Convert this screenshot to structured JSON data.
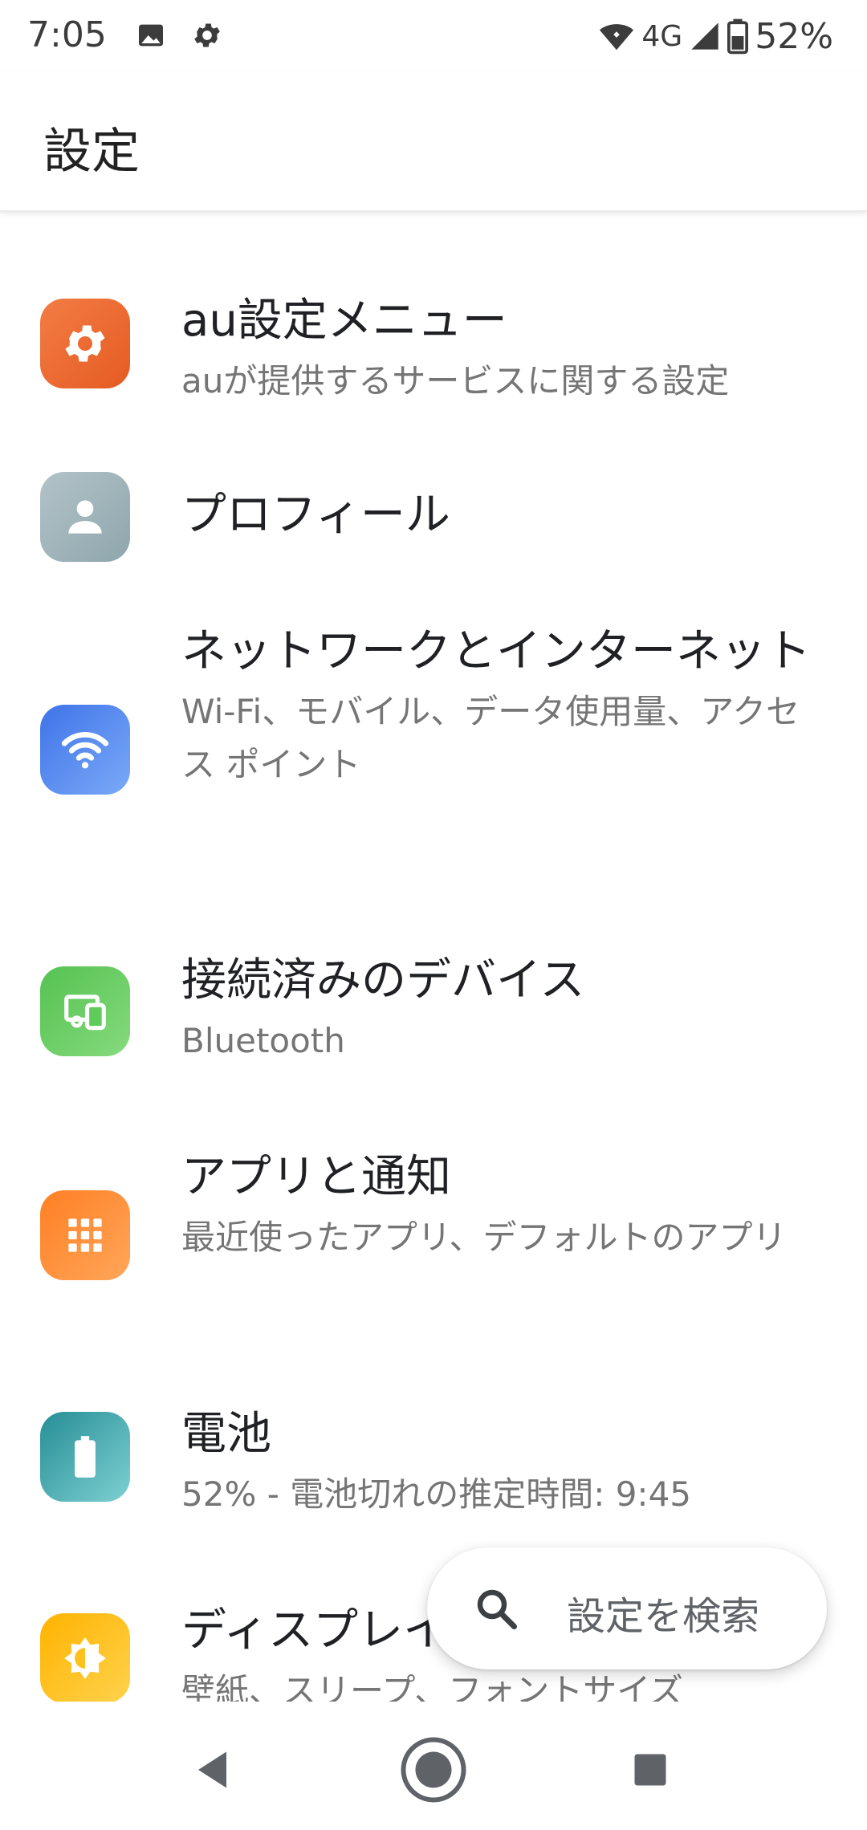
{
  "status_bar": {
    "time": "7:05",
    "icons": [
      "image-icon",
      "gear-icon"
    ],
    "network": "4G",
    "battery_percent": "52%"
  },
  "header": {
    "title": "設定"
  },
  "settings": {
    "items": [
      {
        "title": "au設定メニュー",
        "subtitle": "auが提供するサービスに関する設定",
        "icon": "gear-icon",
        "color": "#EE6A2E"
      },
      {
        "title": "プロフィール",
        "subtitle": "",
        "icon": "person-icon",
        "color": "#9EB3BA"
      },
      {
        "title": "ネットワークとインターネット",
        "subtitle": "Wi-Fi、モバイル、データ使用量、アクセス ポイント",
        "icon": "wifi-icon",
        "color": "#4A84F0"
      },
      {
        "title": "接続済みのデバイス",
        "subtitle": "Bluetooth",
        "icon": "devices-icon",
        "color": "#5FCB5B"
      },
      {
        "title": "アプリと通知",
        "subtitle": "最近使ったアプリ、デフォルトのアプリ",
        "icon": "apps-grid-icon",
        "color": "#FF8A33"
      },
      {
        "title": "電池",
        "subtitle": "52% - 電池切れの推定時間: 9:45",
        "icon": "battery-icon",
        "color": "#2F9EA6"
      },
      {
        "title": "ディスプレイ",
        "subtitle": "壁紙、スリープ、フォントサイズ",
        "icon": "brightness-icon",
        "color": "#FFC21C"
      }
    ]
  },
  "search": {
    "label": "設定を検索",
    "icon": "search-icon"
  },
  "nav": {
    "back": "back-icon",
    "home": "home-icon",
    "recents": "recents-icon"
  }
}
